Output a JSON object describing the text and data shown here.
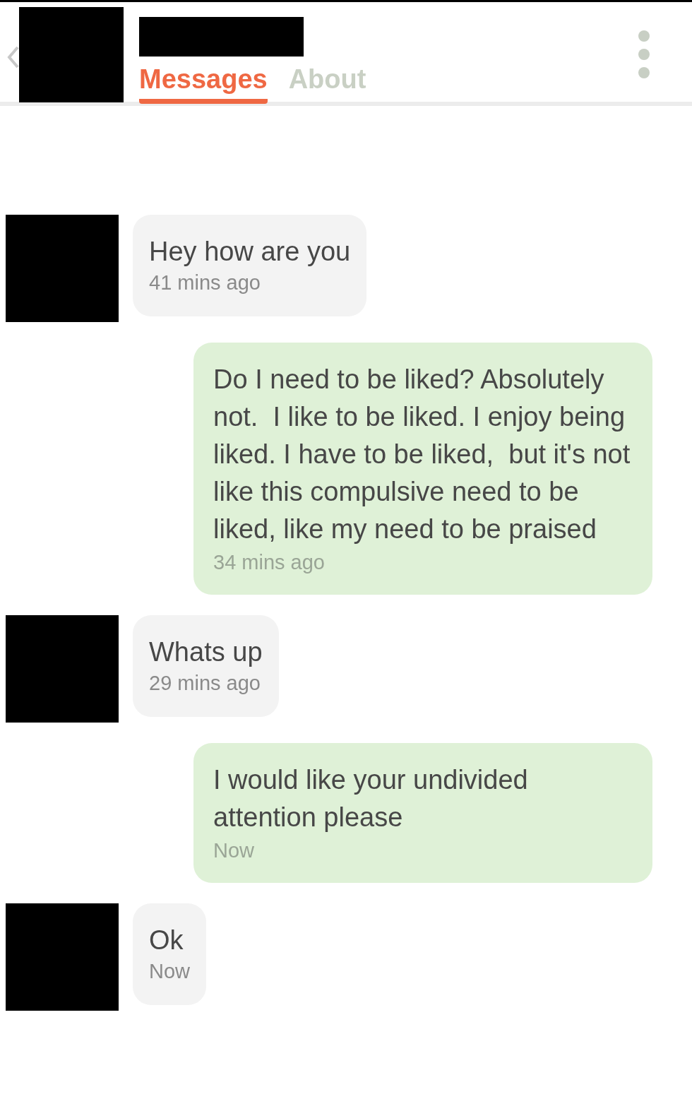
{
  "header": {
    "tabs": [
      {
        "label": "Messages",
        "selected": true
      },
      {
        "label": "About",
        "selected": false
      }
    ]
  },
  "messages": [
    {
      "kind": "received",
      "text": "Hey how are you",
      "time": "41 mins ago"
    },
    {
      "kind": "sent",
      "text": "Do I need to be liked? Absolutely not.  I like to be liked. I enjoy being liked. I have to be liked,  but it's not like this compulsive need to be liked, like my need to be praised",
      "time": "34 mins ago"
    },
    {
      "kind": "received",
      "text": "Whats up",
      "time": "29 mins ago"
    },
    {
      "kind": "sent",
      "text": "I would like your undivided attention please",
      "time": "Now"
    },
    {
      "kind": "received",
      "text": "Ok",
      "time": "Now"
    }
  ]
}
